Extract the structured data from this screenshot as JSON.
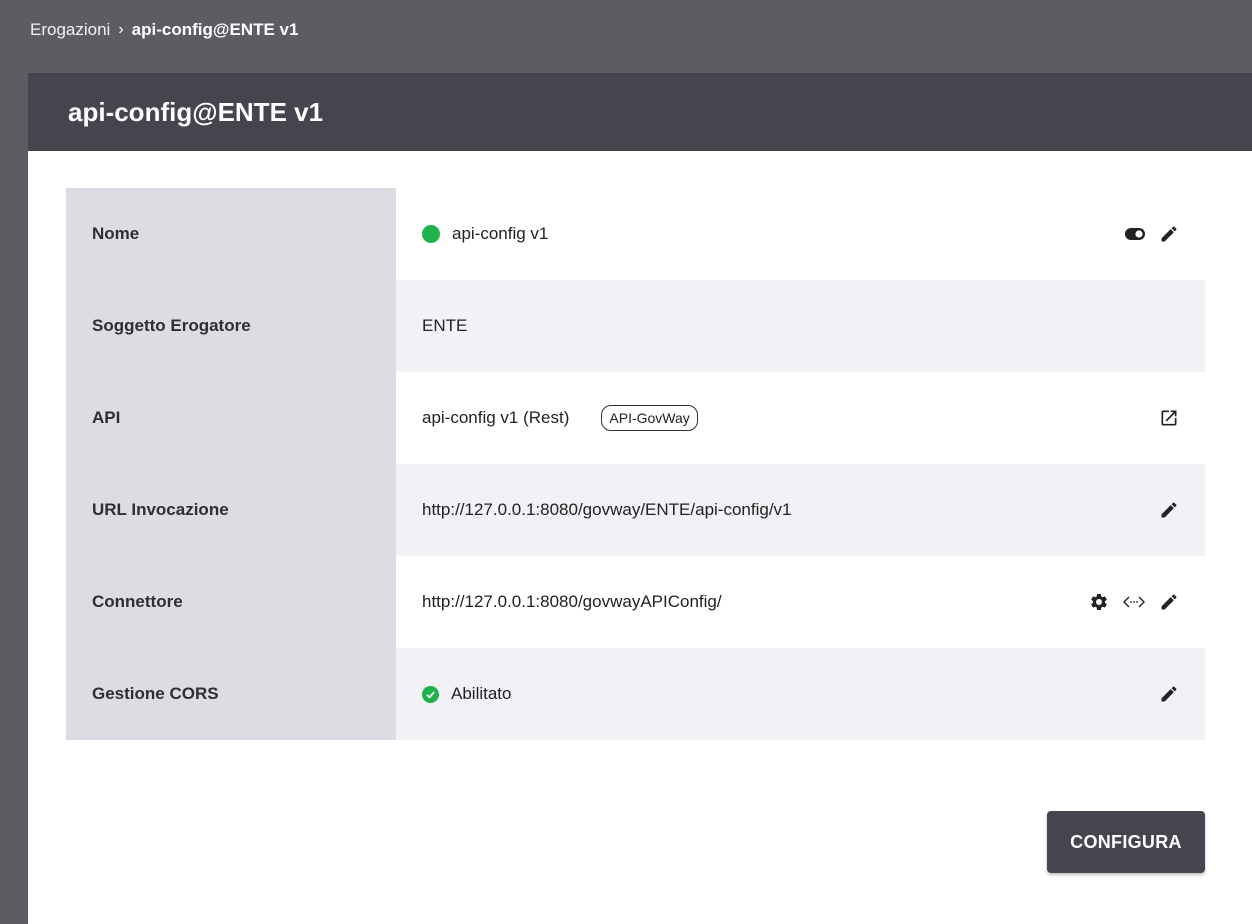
{
  "breadcrumb": {
    "parent": "Erogazioni",
    "separator": "›",
    "current": "api-config@ENTE v1"
  },
  "panel": {
    "title": "api-config@ENTE v1"
  },
  "rows": {
    "nome": {
      "label": "Nome",
      "value": "api-config v1",
      "status_color": "#20b24a",
      "icons": [
        "toggle-icon",
        "pencil-icon"
      ]
    },
    "soggetto": {
      "label": "Soggetto Erogatore",
      "value": "ENTE"
    },
    "api": {
      "label": "API",
      "value": "api-config v1 (Rest)",
      "tag": "API-GovWay",
      "icons": [
        "open-external-icon"
      ]
    },
    "url": {
      "label": "URL Invocazione",
      "value": "http://127.0.0.1:8080/govway/ENTE/api-config/v1",
      "icons": [
        "pencil-icon"
      ]
    },
    "connettore": {
      "label": "Connettore",
      "value": "http://127.0.0.1:8080/govwayAPIConfig/",
      "icons": [
        "gear-icon",
        "code-icon",
        "pencil-icon"
      ]
    },
    "cors": {
      "label": "Gestione CORS",
      "value": "Abilitato",
      "status_color": "#20b24a",
      "icons": [
        "pencil-icon"
      ]
    }
  },
  "actions": {
    "configura_label": "CONFIGURA"
  },
  "colors": {
    "background": "#5c5d62",
    "header": "#45464d",
    "label_bg": "#dcdde3",
    "alt_row_bg": "#f1f2f6",
    "success": "#20b24a"
  }
}
